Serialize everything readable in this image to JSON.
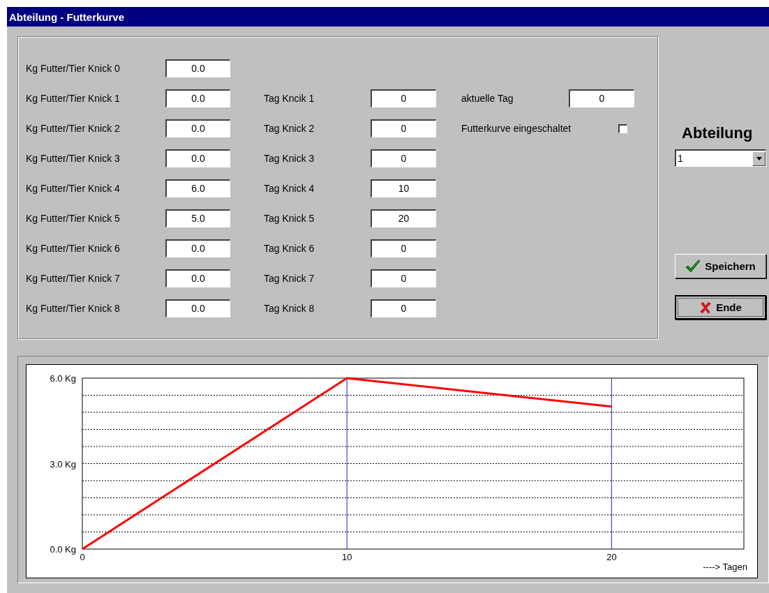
{
  "window": {
    "title": "Abteilung - Futterkurve"
  },
  "form": {
    "kg_rows": [
      {
        "label": "Kg Futter/Tier Knick 0",
        "value": "0.0"
      },
      {
        "label": "Kg Futter/Tier Knick 1",
        "value": "0.0"
      },
      {
        "label": "Kg Futter/Tier Knick 2",
        "value": "0.0"
      },
      {
        "label": "Kg Futter/Tier Knick 3",
        "value": "0.0"
      },
      {
        "label": "Kg Futter/Tier Knick 4",
        "value": "6.0"
      },
      {
        "label": "Kg Futter/Tier Knick 5",
        "value": "5.0"
      },
      {
        "label": "Kg Futter/Tier Knick 6",
        "value": "0.0"
      },
      {
        "label": "Kg Futter/Tier Knick 7",
        "value": "0.0"
      },
      {
        "label": "Kg Futter/Tier Knick 8",
        "value": "0.0"
      }
    ],
    "tag_rows": [
      {
        "label": "Tag Kncik 1",
        "value": "0"
      },
      {
        "label": "Tag Knick 2",
        "value": "0"
      },
      {
        "label": "Tag Knick 3",
        "value": "0"
      },
      {
        "label": "Tag Knick 4",
        "value": "10"
      },
      {
        "label": "Tag Knick 5",
        "value": "20"
      },
      {
        "label": "Tag Knick 6",
        "value": "0"
      },
      {
        "label": "Tag Knick 7",
        "value": "0"
      },
      {
        "label": "Tag Knick 8",
        "value": "0"
      }
    ],
    "current_day": {
      "label": "aktuelle Tag",
      "value": "0"
    },
    "curve_enabled": {
      "label": "Futterkurve eingeschaltet",
      "checked": false
    }
  },
  "department": {
    "label": "Abteilung",
    "value": "1"
  },
  "buttons": [
    {
      "label": "Speichern",
      "kind": "save",
      "focused": false
    },
    {
      "label": "Ende",
      "kind": "exit",
      "focused": true
    }
  ],
  "chart_data": {
    "type": "line",
    "xlabel": "----> Tagen",
    "x": [
      0,
      10,
      20
    ],
    "series": [
      {
        "color": "#ff0000",
        "values": [
          0,
          6,
          5
        ]
      }
    ],
    "xlim": [
      0,
      25
    ],
    "ylim": [
      0,
      6
    ],
    "xticks": [
      0,
      10,
      20
    ],
    "yticks": [
      {
        "value": 0,
        "label": "0.0 Kg"
      },
      {
        "value": 3,
        "label": "3.0 Kg"
      },
      {
        "value": 6,
        "label": "6.0 Kg"
      }
    ]
  }
}
